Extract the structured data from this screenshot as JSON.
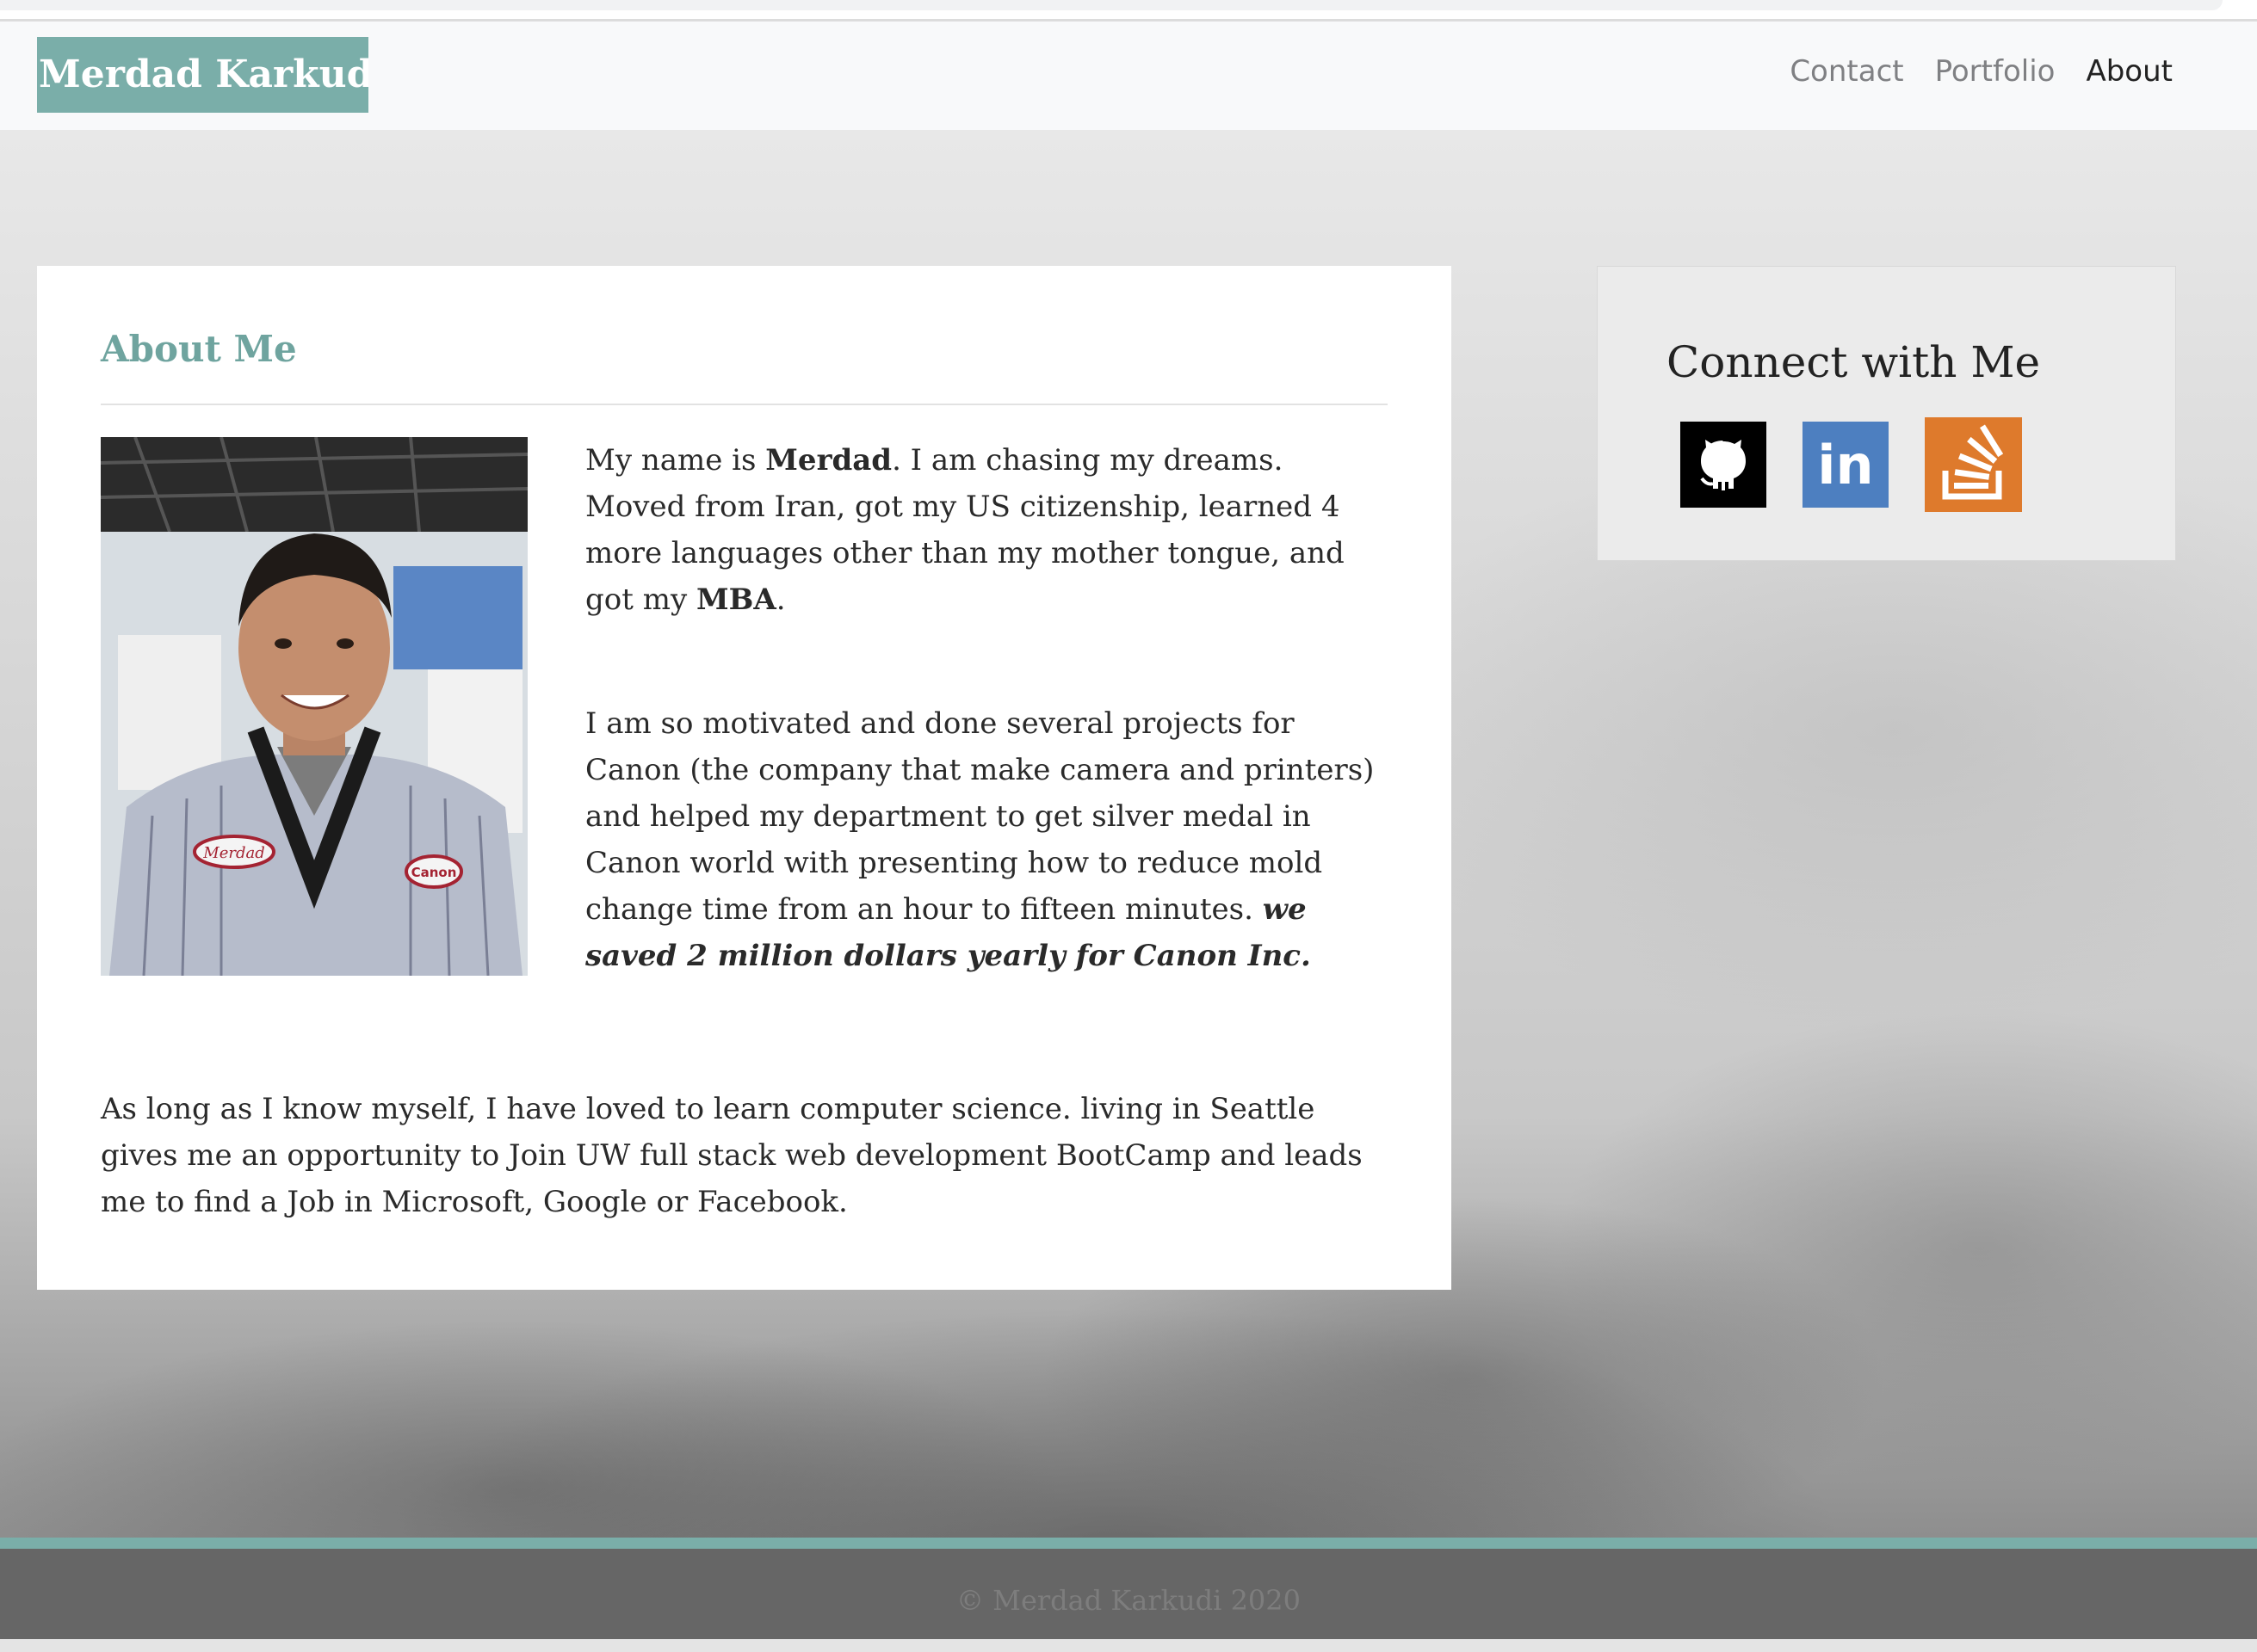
{
  "brand": "Merdad Karkudi",
  "nav": {
    "contact": "Contact",
    "portfolio": "Portfolio",
    "about": "About"
  },
  "about": {
    "title": "About Me",
    "p1": {
      "a": "My name is ",
      "b": "Merdad",
      "c": ". I am chasing my dreams. Moved from Iran, got my US citizenship, learned 4 more languages other than my mother tongue, and got my ",
      "d": "MBA",
      "e": "."
    },
    "p2": {
      "a": "I am so motivated and done several projects for Canon (the company that make camera and printers) and helped my department to get silver medal in Canon world with presenting how to reduce mold change time from an hour to fifteen minutes. ",
      "b": "we saved 2 million dollars yearly for Canon Inc."
    },
    "p3": "As long as I know myself, I have loved to learn computer science. living in Seattle gives me an opportunity to Join UW full stack web development BootCamp and leads me to find a Job in Microsoft, Google or Facebook.",
    "photo_badges": {
      "name": "Merdad",
      "logo": "Canon"
    }
  },
  "connect": {
    "title": "Connect with Me",
    "icons": [
      "github-icon",
      "linkedin-icon",
      "stackoverflow-icon"
    ],
    "linkedin_text": "in"
  },
  "footer": "© Merdad Karkudi 2020",
  "colors": {
    "accent": "#7aaea9",
    "github": "#000000",
    "linkedin": "#4d7fc0",
    "stackoverflow": "#de7a2c",
    "footer": "#666666"
  }
}
